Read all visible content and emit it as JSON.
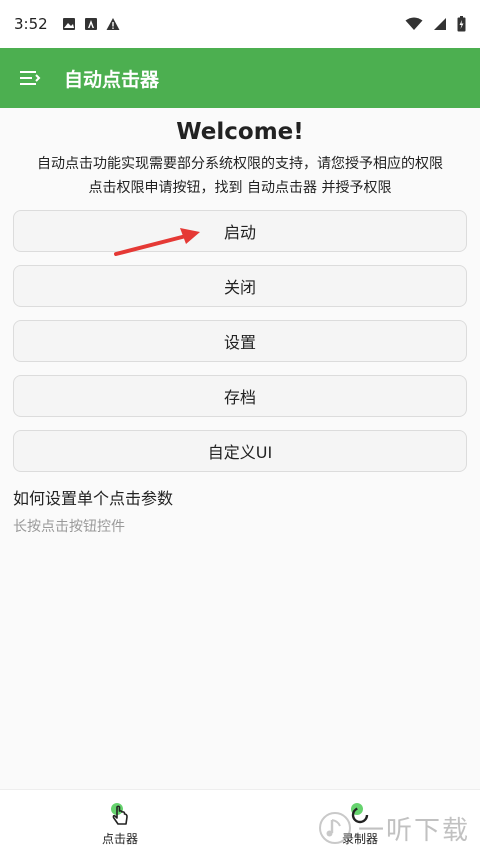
{
  "status_bar": {
    "time": "3:52"
  },
  "app_bar": {
    "title": "自动点击器"
  },
  "main": {
    "welcome": "Welcome!",
    "description_line1": "自动点击功能实现需要部分系统权限的支持，请您授予相应的权限",
    "description_line2": "点击权限申请按钮，找到 自动点击器 并授予权限",
    "buttons": {
      "start": "启动",
      "close": "关闭",
      "settings": "设置",
      "archive": "存档",
      "custom_ui": "自定义UI"
    },
    "help_title": "如何设置单个点击参数",
    "help_subtitle": "长按点击按钮控件"
  },
  "bottom_nav": {
    "items": [
      {
        "label": "点击器",
        "icon": "hand-tap-icon"
      },
      {
        "label": "录制器",
        "icon": "record-icon"
      }
    ]
  },
  "watermark": {
    "text": "一听下载"
  },
  "colors": {
    "accent": "#4caf50",
    "arrow": "#e53935",
    "nav_icon_dot": "#66d36e"
  }
}
